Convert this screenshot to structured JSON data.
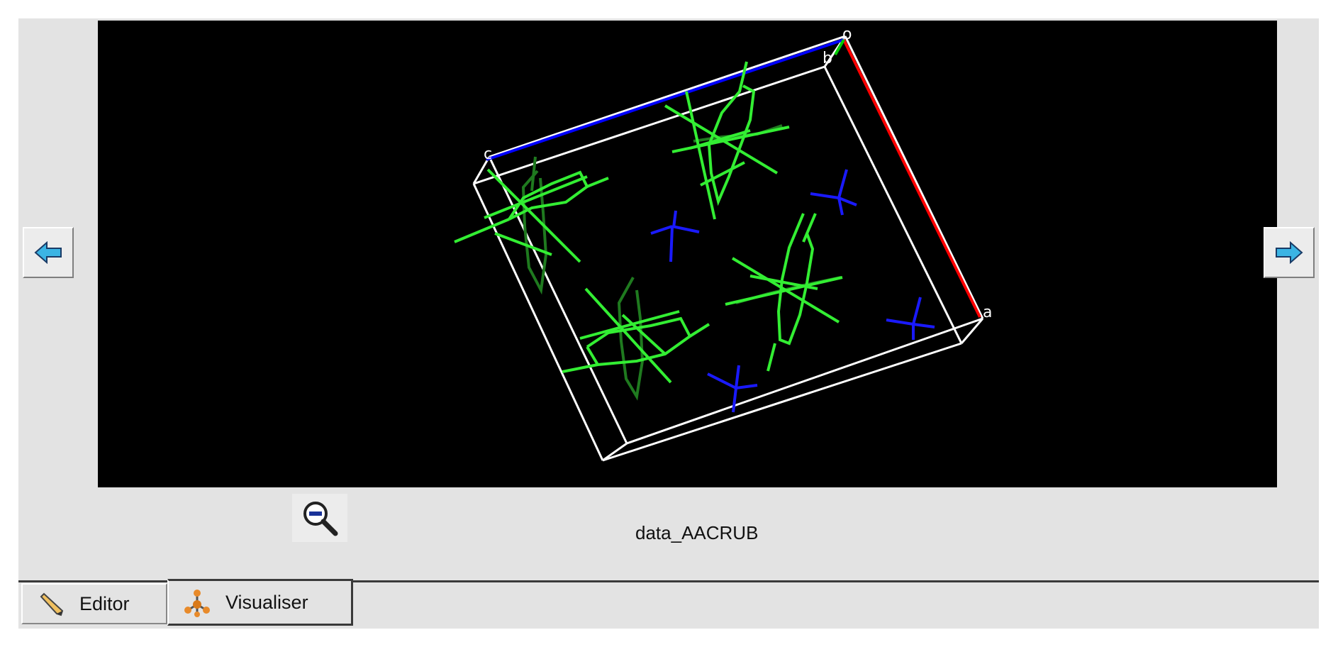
{
  "viewer": {
    "background": "#000000",
    "axis_labels": {
      "origin": "o",
      "a": "a",
      "b": "b",
      "c": "c"
    },
    "axis_colors": {
      "a": "#ff0000",
      "b": "#00cc00",
      "c": "#0000ff"
    },
    "molecule_color": "#33ee33",
    "counterion_color": "#1a1aff"
  },
  "navigation": {
    "prev_icon": "arrow-left-icon",
    "next_icon": "arrow-right-icon"
  },
  "zoom": {
    "icon": "zoom-out-icon"
  },
  "dataset": {
    "name": "data_AACRUB"
  },
  "tabs": [
    {
      "label": "Editor",
      "icon": "pencil-icon",
      "active": false
    },
    {
      "label": "Visualiser",
      "icon": "molecule-icon",
      "active": true
    }
  ]
}
